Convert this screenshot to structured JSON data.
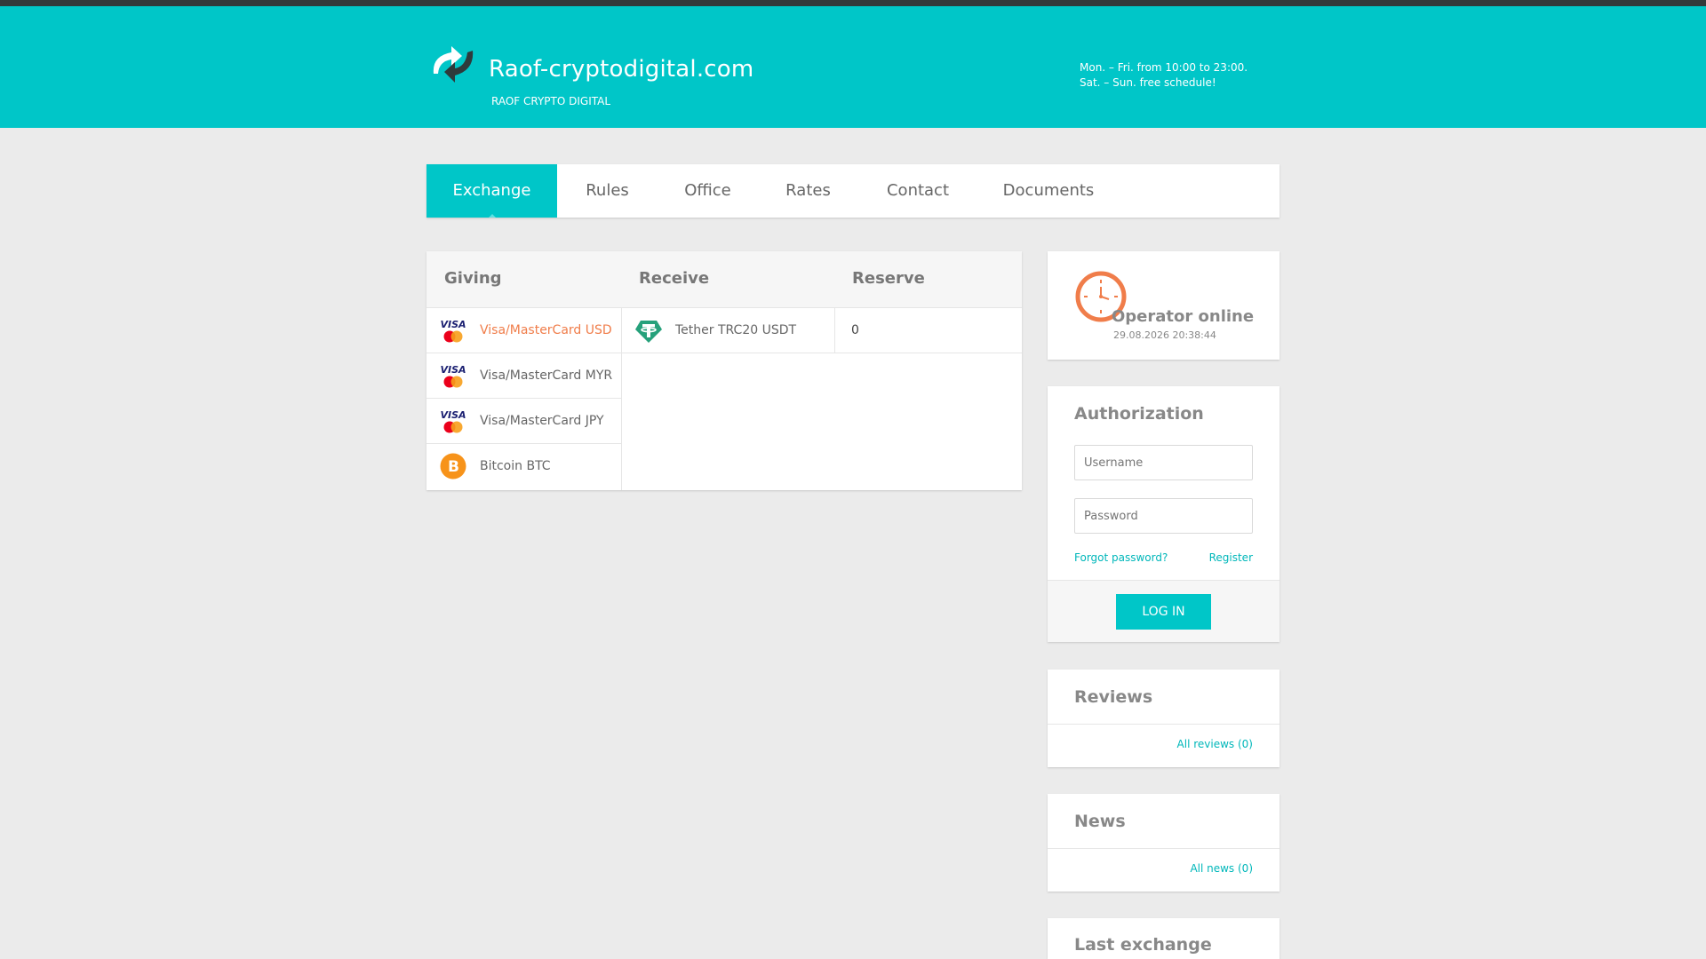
{
  "header": {
    "title": "Raof-cryptodigital.com",
    "subtitle": "RAOF CRYPTO DIGITAL",
    "hours_weekday": "Mon. – Fri. from 10:00 to 23:00.",
    "hours_weekend": "Sat. – Sun. free schedule!"
  },
  "nav": {
    "items": [
      {
        "label": "Exchange"
      },
      {
        "label": "Rules"
      },
      {
        "label": "Office"
      },
      {
        "label": "Rates"
      },
      {
        "label": "Contact"
      },
      {
        "label": "Documents"
      }
    ]
  },
  "exchange": {
    "headers": {
      "giving": "Giving",
      "receive": "Receive",
      "reserve": "Reserve"
    },
    "giving": [
      {
        "label": "Visa/MasterCard USD",
        "icon": "visa-mastercard-icon"
      },
      {
        "label": "Visa/MasterCard MYR",
        "icon": "visa-mastercard-icon"
      },
      {
        "label": "Visa/MasterCard JPY",
        "icon": "visa-mastercard-icon"
      },
      {
        "label": "Bitcoin BTC",
        "icon": "bitcoin-icon"
      }
    ],
    "receive": [
      {
        "label": "Tether TRC20 USDT",
        "icon": "tether-icon",
        "reserve": "0"
      }
    ]
  },
  "operator": {
    "status": "Operator online",
    "datetime": "29.08.2026 20:38:44"
  },
  "auth": {
    "title": "Authorization",
    "username_placeholder": "Username",
    "password_placeholder": "Password",
    "forgot": "Forgot password?",
    "register": "Register",
    "login": "LOG IN"
  },
  "reviews": {
    "title": "Reviews",
    "link": "All reviews (0)"
  },
  "news": {
    "title": "News",
    "link": "All news (0)"
  },
  "last_exchange": {
    "title": "Last exchange"
  },
  "colors": {
    "accent": "#00c6c8",
    "highlight": "#f07d4a",
    "background": "#ebebeb"
  }
}
